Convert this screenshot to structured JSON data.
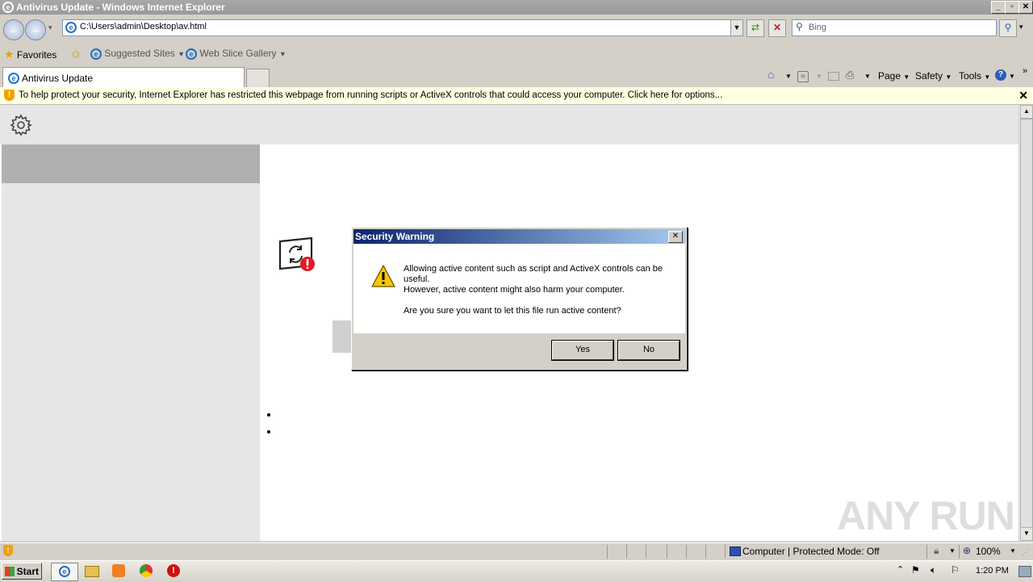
{
  "window": {
    "title": "Antivirus Update - Windows Internet Explorer"
  },
  "address_bar": {
    "url": "C:\\Users\\admin\\Desktop\\av.html"
  },
  "search": {
    "placeholder": "Bing"
  },
  "favorites_bar": {
    "favorites_label": "Favorites",
    "items": [
      {
        "label": "Suggested Sites"
      },
      {
        "label": "Web Slice Gallery"
      }
    ]
  },
  "tabs": [
    {
      "label": "Antivirus Update"
    }
  ],
  "command_bar": {
    "page": "Page",
    "safety": "Safety",
    "tools": "Tools"
  },
  "info_bar": {
    "message": "To help protect your security, Internet Explorer has restricted this webpage from running scripts or ActiveX controls that could access your computer. Click here for options..."
  },
  "dialog": {
    "title": "Security Warning",
    "line1": "Allowing active content such as script and ActiveX controls can be",
    "line2": "useful.",
    "line3": "However, active content might also harm your computer.",
    "line4": "Are you sure you want to let this file run active content?",
    "yes_label": "Yes",
    "no_label": "No"
  },
  "status_bar": {
    "zone": "Computer | Protected Mode: Off",
    "zoom": "100%"
  },
  "taskbar": {
    "start_label": "Start",
    "clock": "1:20 PM"
  },
  "watermark": "ANY RUN",
  "colors": {
    "dialog_title_start": "#0a246a",
    "dialog_title_end": "#a6caf0",
    "info_bar": "#ffffe1",
    "alert_red": "#e01b24"
  }
}
